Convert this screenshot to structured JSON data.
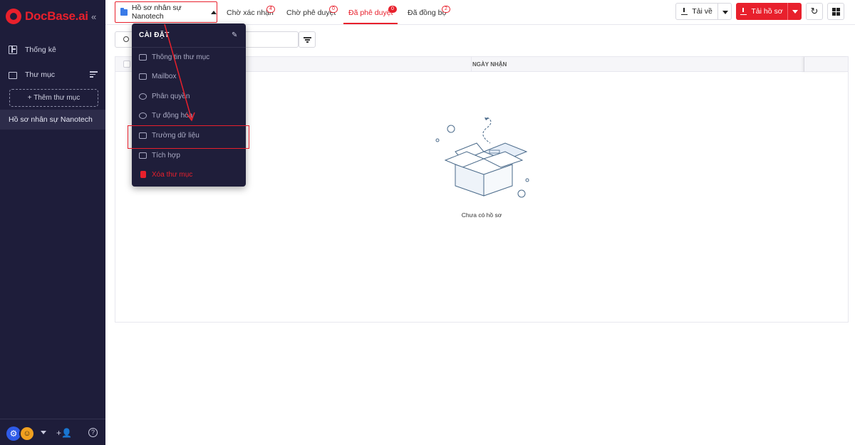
{
  "brand": {
    "name": "DocBase.ai",
    "color": "#e8202c"
  },
  "sidebar": {
    "collapse_glyph": "«",
    "items": [
      {
        "label": "Thống kê",
        "icon": "dashboard-icon"
      },
      {
        "label": "Thư mục",
        "icon": "folder-icon"
      }
    ],
    "add_folder_label": "+ Thêm thư mục",
    "active_folder": "Hồ sơ nhân sự Nanotech",
    "help_glyph": "?"
  },
  "topbar": {
    "folder_select_label": "Hồ sơ nhân sự Nanotech",
    "tabs": [
      {
        "label": "Chờ xác nhận",
        "count": "4"
      },
      {
        "label": "Chờ phê duyệt",
        "count": "0"
      },
      {
        "label": "Đã phê duyệt",
        "count": "0",
        "active": true
      },
      {
        "label": "Đã đồng bộ",
        "count": "2"
      }
    ],
    "download_label": "Tải về",
    "upload_label": "Tải hồ sơ"
  },
  "table": {
    "columns": [
      "NGÀY NHẬN"
    ],
    "empty_text": "Chưa có hồ sơ"
  },
  "menu": {
    "title": "CÀI ĐẶT",
    "items": [
      {
        "label": "Thông tin thư mục",
        "icon": "folder-icon"
      },
      {
        "label": "Mailbox",
        "icon": "mail-icon"
      },
      {
        "label": "Phân quyền",
        "icon": "permission-icon"
      },
      {
        "label": "Tự động hóa",
        "icon": "automation-icon"
      },
      {
        "label": "Trường dữ liệu",
        "icon": "data-field-icon",
        "highlighted": true
      },
      {
        "label": "Tích hợp",
        "icon": "integration-icon"
      },
      {
        "label": "Xóa thư mục",
        "icon": "trash-icon",
        "danger": true
      }
    ]
  }
}
